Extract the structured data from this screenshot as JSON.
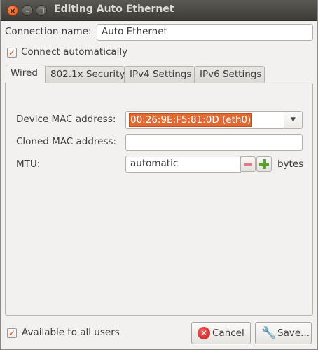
{
  "window": {
    "title": "Editing Auto Ethernet",
    "close_glyph": "×",
    "minimize_glyph": "–",
    "maximize_glyph": "□"
  },
  "connection": {
    "name_label": "Connection name:",
    "name_value": "Auto Ethernet",
    "connect_auto_label": "Connect automatically",
    "connect_auto_checked": true
  },
  "tabs": [
    {
      "label": "Wired",
      "active": true
    },
    {
      "label": "802.1x Security",
      "active": false
    },
    {
      "label": "IPv4 Settings",
      "active": false
    },
    {
      "label": "IPv6 Settings",
      "active": false
    }
  ],
  "wired": {
    "device_mac_label": "Device MAC address:",
    "device_mac_value": "00:26:9E:F5:81:0D (eth0)",
    "cloned_mac_label": "Cloned MAC address:",
    "cloned_mac_value": "",
    "mtu_label": "MTU:",
    "mtu_value": "automatic",
    "mtu_unit": "bytes"
  },
  "footer": {
    "all_users_label": "Available to all users",
    "all_users_checked": true,
    "cancel_label": "Cancel",
    "save_label": "Save..."
  },
  "colors": {
    "accent": "#e06a34",
    "titlebar": "#3d3c37",
    "background": "#f2f1f0"
  }
}
